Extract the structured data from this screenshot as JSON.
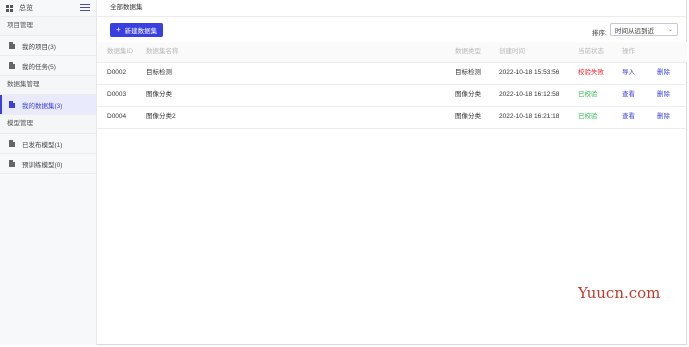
{
  "sidebar": {
    "title": "总览",
    "sections": [
      {
        "title": "项目管理",
        "items": [
          {
            "label": "我的项目(3)",
            "active": false
          },
          {
            "label": "我的任务(5)",
            "active": false
          }
        ]
      },
      {
        "title": "数据集管理",
        "items": [
          {
            "label": "我的数据集(3)",
            "active": true
          }
        ]
      },
      {
        "title": "模型管理",
        "items": [
          {
            "label": "已发布模型(1)",
            "active": false
          },
          {
            "label": "预训练模型(0)",
            "active": false
          }
        ]
      }
    ]
  },
  "main": {
    "breadcrumb": "全部数据集",
    "new_button": "新建数据集",
    "sort_label": "排序:",
    "sort_value": "时间从远到近",
    "table": {
      "headers": [
        "数据集ID",
        "数据集名称",
        "数据类型",
        "创建时间",
        "当前状态",
        "操作"
      ],
      "rows": [
        {
          "id": "D0002",
          "name": "目标检测",
          "type": "目标检测",
          "time": "2022-10-18 15:53:56",
          "status": "校验失败",
          "status_kind": "fail",
          "action1": "导入",
          "action2": "删除"
        },
        {
          "id": "D0003",
          "name": "图像分类",
          "type": "图像分类",
          "time": "2022-10-18 16:12:58",
          "status": "已校验",
          "status_kind": "ok",
          "action1": "查看",
          "action2": "删除"
        },
        {
          "id": "D0004",
          "name": "图像分类2",
          "type": "图像分类",
          "time": "2022-10-18 16:21:18",
          "status": "已校验",
          "status_kind": "ok",
          "action1": "查看",
          "action2": "删除"
        }
      ]
    }
  },
  "watermark": "Yuucn.com",
  "colors": {
    "accent": "#3a3fe0",
    "fail": "#f5222d",
    "ok": "#2db84b"
  }
}
